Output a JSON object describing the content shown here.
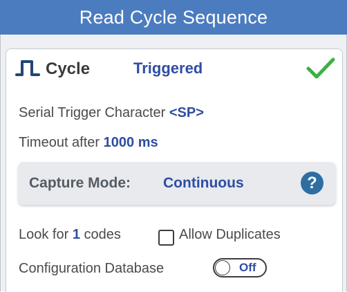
{
  "header": {
    "title": "Read Cycle Sequence"
  },
  "cycle": {
    "label": "Cycle",
    "value": "Triggered",
    "icon": "pulse-icon",
    "status_icon": "check-icon",
    "status_color": "#3cb043"
  },
  "trigger": {
    "label": "Serial Trigger Character",
    "value": "<SP>"
  },
  "timeout": {
    "label": "Timeout after",
    "value": "1000 ms"
  },
  "capture": {
    "label": "Capture Mode:",
    "value": "Continuous",
    "help_glyph": "?"
  },
  "codes": {
    "prefix": "Look for",
    "count": "1",
    "suffix": "codes",
    "allow_duplicates_label": "Allow Duplicates",
    "allow_duplicates_checked": false
  },
  "config_db": {
    "label": "Configuration Database",
    "toggle_text": "Off",
    "enabled": false
  },
  "colors": {
    "header_bg": "#4b7cbf",
    "accent": "#2e4da3",
    "help_bg": "#2f6ea3"
  }
}
